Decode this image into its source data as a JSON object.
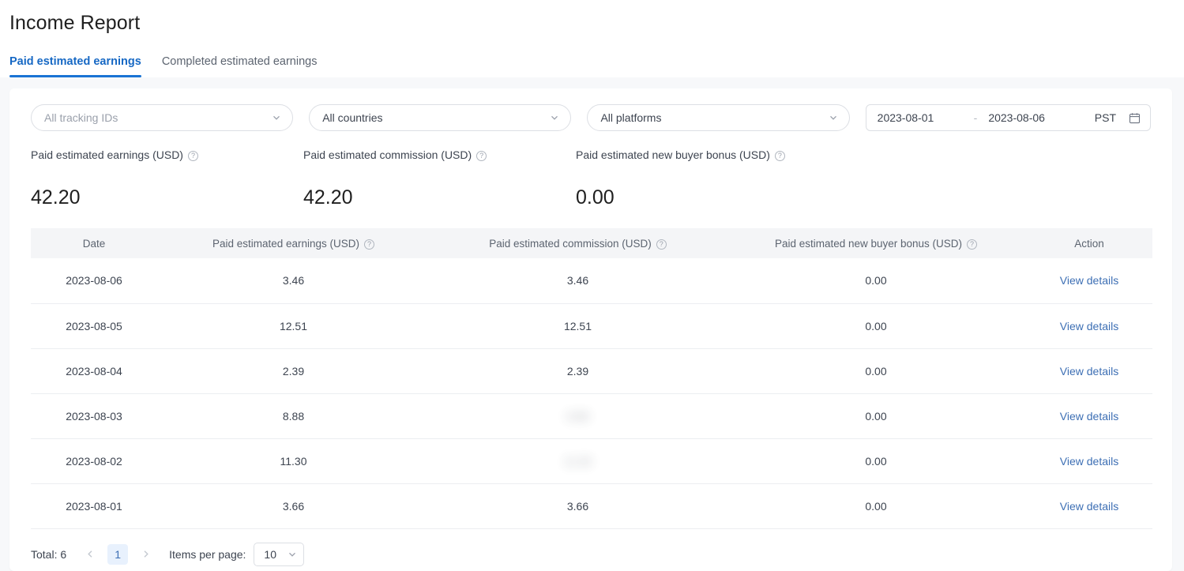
{
  "header": {
    "title": "Income Report"
  },
  "tabs": [
    {
      "label": "Paid estimated earnings",
      "active": true
    },
    {
      "label": "Completed estimated earnings",
      "active": false
    }
  ],
  "filters": {
    "tracking_ids": {
      "value": "All tracking IDs",
      "is_placeholder": true
    },
    "countries": {
      "value": "All countries"
    },
    "platforms": {
      "value": "All platforms"
    },
    "date_range": {
      "start": "2023-08-01",
      "separator": "-",
      "end": "2023-08-06",
      "timezone": "PST",
      "calendar_icon": "calendar-icon"
    },
    "chevron_icon": "chevron-down-icon"
  },
  "summary": [
    {
      "label": "Paid estimated earnings (USD)",
      "help_icon": "help-circle-icon",
      "value": "42.20"
    },
    {
      "label": "Paid estimated commission (USD)",
      "help_icon": "help-circle-icon",
      "value": "42.20"
    },
    {
      "label": "Paid estimated new buyer bonus (USD)",
      "help_icon": "help-circle-icon",
      "value": "0.00"
    }
  ],
  "table": {
    "columns": [
      {
        "label": "Date",
        "has_help": false
      },
      {
        "label": "Paid estimated earnings (USD)",
        "has_help": true
      },
      {
        "label": "Paid estimated commission (USD)",
        "has_help": true
      },
      {
        "label": "Paid estimated new buyer bonus (USD)",
        "has_help": true
      },
      {
        "label": "Action",
        "has_help": false
      }
    ],
    "rows": [
      {
        "date": "2023-08-06",
        "earnings": "3.46",
        "commission": "3.46",
        "commission_blurred": false,
        "bonus": "0.00",
        "action": "View details"
      },
      {
        "date": "2023-08-05",
        "earnings": "12.51",
        "commission": "12.51",
        "commission_blurred": false,
        "bonus": "0.00",
        "action": "View details"
      },
      {
        "date": "2023-08-04",
        "earnings": "2.39",
        "commission": "2.39",
        "commission_blurred": false,
        "bonus": "0.00",
        "action": "View details"
      },
      {
        "date": "2023-08-03",
        "earnings": "8.88",
        "commission": "8.88",
        "commission_blurred": true,
        "bonus": "0.00",
        "action": "View details"
      },
      {
        "date": "2023-08-02",
        "earnings": "11.30",
        "commission": "11.30",
        "commission_blurred": true,
        "bonus": "0.00",
        "action": "View details"
      },
      {
        "date": "2023-08-01",
        "earnings": "3.66",
        "commission": "3.66",
        "commission_blurred": false,
        "bonus": "0.00",
        "action": "View details"
      }
    ]
  },
  "pagination": {
    "total_label": "Total: 6",
    "prev_icon": "chevron-left-icon",
    "next_icon": "chevron-right-icon",
    "current_page": "1",
    "items_per_page_label": "Items per page:",
    "items_per_page_value": "10"
  },
  "colors": {
    "accent": "#1a73d4",
    "link": "#3d6fb4",
    "page_bg": "#f7f8fa",
    "header_row_bg": "#f4f5f7"
  }
}
